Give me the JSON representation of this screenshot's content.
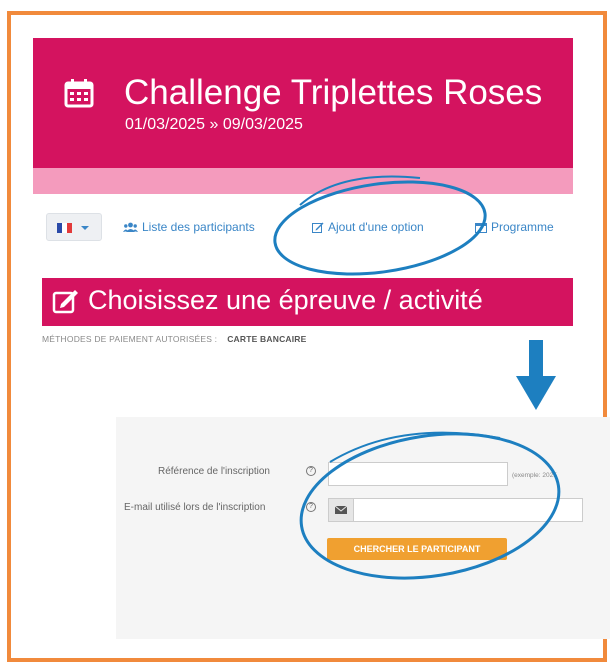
{
  "event": {
    "title": "Challenge Triplettes Roses",
    "dates": "01/03/2025 » 09/03/2025"
  },
  "nav": {
    "language_flag": "fr-flag",
    "links": [
      {
        "label": "Liste des participants",
        "icon": "users-icon"
      },
      {
        "label": "Ajout d'une option",
        "icon": "edit-icon"
      },
      {
        "label": "Programme",
        "icon": "calendar-icon"
      }
    ]
  },
  "section": {
    "title": "Choisissez une épreuve / activité",
    "payment_label": "MÉTHODES DE PAIEMENT AUTORISÉES :",
    "payment_value": "CARTE BANCAIRE"
  },
  "form": {
    "reference_label": "Référence de l'inscription",
    "reference_value": "",
    "reference_hint": "(exemple: 2025",
    "email_label": "E-mail utilisé lors de l'inscription",
    "email_value": "",
    "search_button": "CHERCHER LE PARTICIPANT"
  },
  "colors": {
    "brand": "#d4135f",
    "band": "#f49bbd",
    "frame": "#f18a3c",
    "link": "#3a86c7",
    "button": "#f0a030",
    "highlight": "#1d7fc0"
  }
}
